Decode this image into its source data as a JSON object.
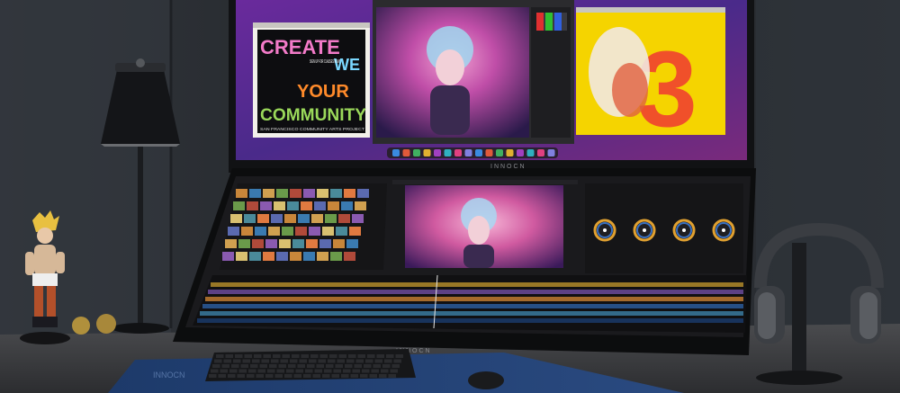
{
  "poster": {
    "lines": [
      "CREATE",
      "WE",
      "YOUR",
      "COMMUNITY"
    ],
    "signup": "SIGN UP FOR CLASSES NOW!",
    "footer": "SAN FRANCISCO COMMUNITY ARTS PROJECT"
  },
  "art_number": "3",
  "brand_mark": "INNOCN",
  "colors": {
    "wall": "#2b2f34",
    "desk": "#3a3b3e",
    "screen_bg": "#5a2a8c",
    "accent_orange": "#f0502a",
    "poster_yellow": "#f5d400"
  },
  "icons": [
    "lamp-icon",
    "figurine-icon",
    "headphones-icon",
    "keyboard-icon",
    "mouse-icon",
    "color-wheel-icon"
  ]
}
